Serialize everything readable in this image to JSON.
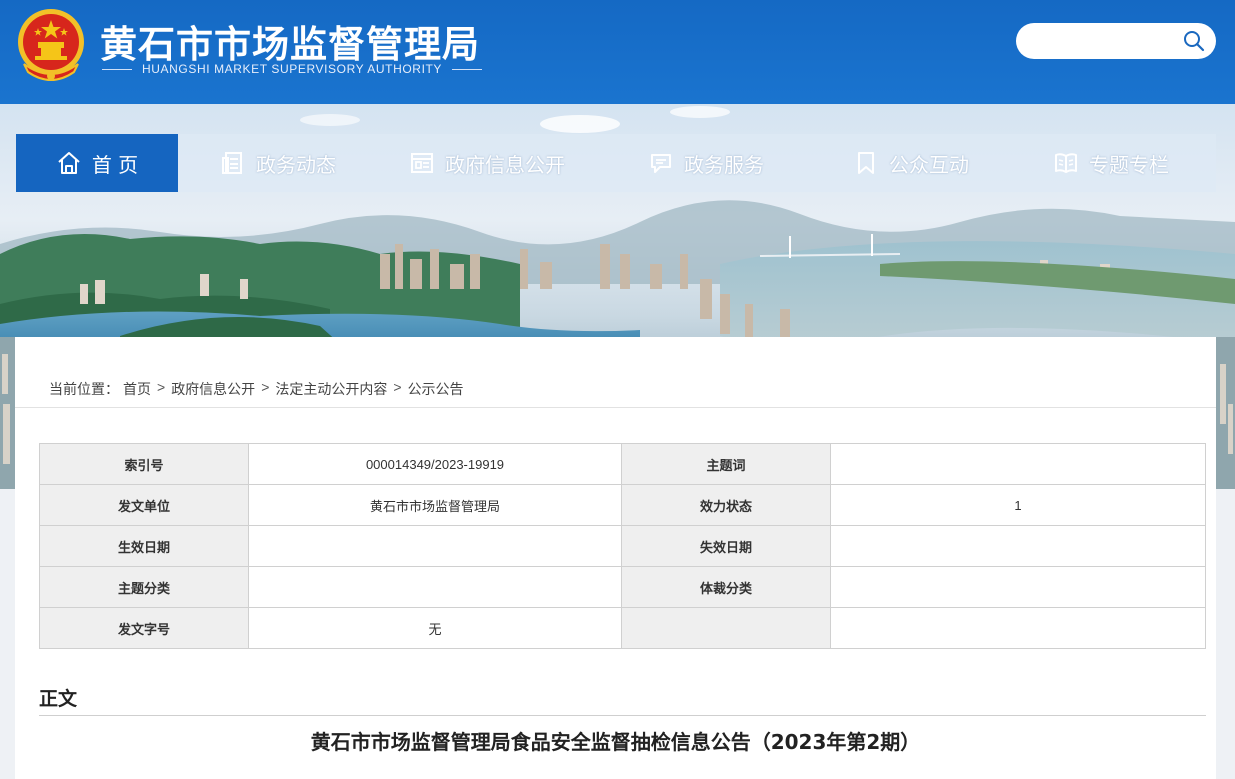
{
  "header": {
    "title": "黄石市市场监督管理局",
    "subtitle": "HUANGSHI MARKET SUPERVISORY AUTHORITY",
    "search_placeholder": ""
  },
  "nav": {
    "items": [
      {
        "label": "首 页",
        "icon": "home-icon",
        "active": true
      },
      {
        "label": "政务动态",
        "icon": "document-list-icon",
        "active": false
      },
      {
        "label": "政府信息公开",
        "icon": "newspaper-icon",
        "active": false
      },
      {
        "label": "政务服务",
        "icon": "chat-bubble-icon",
        "active": false
      },
      {
        "label": "公众互动",
        "icon": "bookmark-icon",
        "active": false
      },
      {
        "label": "专题专栏",
        "icon": "open-book-icon",
        "active": false
      }
    ]
  },
  "breadcrumb": {
    "prefix": "当前位置：",
    "items": [
      "首页",
      "政府信息公开",
      "法定主动公开内容",
      "公示公告"
    ],
    "separator": ">"
  },
  "meta_table": {
    "rows": [
      {
        "k1": "索引号",
        "v1": "000014349/2023-19919",
        "k2": "主题词",
        "v2": ""
      },
      {
        "k1": "发文单位",
        "v1": "黄石市市场监督管理局",
        "k2": "效力状态",
        "v2": "1"
      },
      {
        "k1": "生效日期",
        "v1": "",
        "k2": "失效日期",
        "v2": ""
      },
      {
        "k1": "主题分类",
        "v1": "",
        "k2": "体裁分类",
        "v2": ""
      },
      {
        "k1": "发文字号",
        "v1": "无",
        "k2": "",
        "v2": ""
      }
    ]
  },
  "content": {
    "section_label": "正文",
    "doc_title": "黄石市市场监督管理局食品安全监督抽检信息公告（2023年第2期）"
  },
  "colors": {
    "header_blue": "#1569c4",
    "nav_active": "#1565c0",
    "emblem_red": "#d7261c",
    "emblem_gold": "#f5c518"
  }
}
